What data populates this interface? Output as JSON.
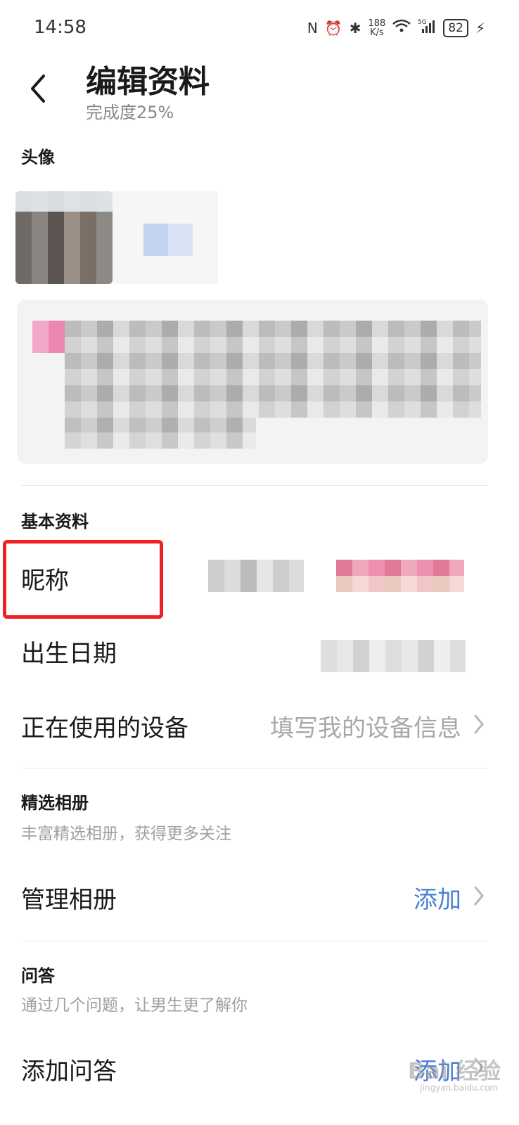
{
  "status_bar": {
    "time": "14:58",
    "net_speed_value": "188",
    "net_speed_unit": "K/s",
    "network": "5G",
    "battery": "82"
  },
  "header": {
    "title": "编辑资料",
    "subtitle": "完成度25%"
  },
  "avatar_section": {
    "heading": "头像"
  },
  "basic_info": {
    "heading": "基本资料",
    "nickname_label": "昵称",
    "birthdate_label": "出生日期",
    "device_label": "正在使用的设备",
    "device_value": "填写我的设备信息"
  },
  "album": {
    "heading": "精选相册",
    "desc": "丰富精选相册，获得更多关注",
    "manage_label": "管理相册",
    "manage_action": "添加"
  },
  "qa": {
    "heading": "问答",
    "desc": "通过几个问题，让男生更了解你",
    "add_label": "添加问答",
    "add_action": "添加"
  },
  "watermark": {
    "text": "Bai 经验",
    "sub": "jingyan.baidu.com"
  },
  "colors": {
    "accent": "#4a7fd6",
    "highlight": "#ee2222",
    "muted": "#a8a8a8"
  }
}
